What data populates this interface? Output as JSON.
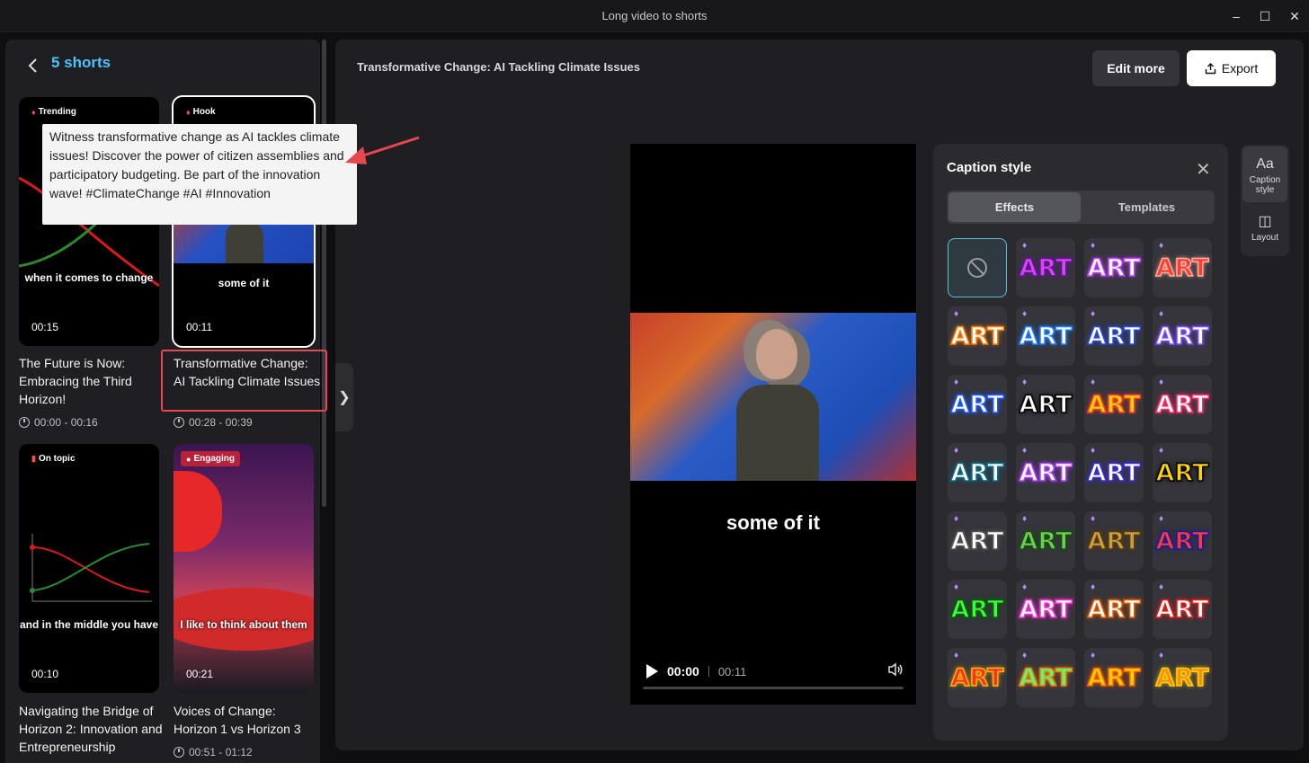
{
  "window": {
    "title": "Long video to shorts",
    "minimize": "–",
    "maximize": "☐",
    "close": "✕"
  },
  "left": {
    "back_icon": "chevron-left-icon",
    "title": "5 shorts",
    "cards": [
      {
        "badge": "Trending",
        "thumb_caption": "when it comes to change",
        "duration": "00:15",
        "title": "The Future is Now: Embracing the Third Horizon!",
        "time": "00:00 - 00:16"
      },
      {
        "badge": "Hook",
        "thumb_caption": "some of it",
        "duration": "00:11",
        "title": "Transformative Change: AI Tackling Climate Issues",
        "time": "00:28 - 00:39"
      },
      {
        "badge": "On topic",
        "thumb_caption": "and in the middle you have",
        "duration": "00:10",
        "title": "Navigating the Bridge of Horizon 2: Innovation and Entrepreneurship",
        "time": ""
      },
      {
        "badge": "Engaging",
        "thumb_caption": "I like to think about them",
        "duration": "00:21",
        "title": "Voices of Change: Horizon 1 vs Horizon 3",
        "time": "00:51 - 01:12"
      }
    ],
    "tooltip": "Witness transformative change as AI tackles climate issues! Discover the power of citizen assemblies and participatory budgeting. Be part of the innovation wave! #ClimateChange #AI #Innovation",
    "collapse_label": "❯"
  },
  "main": {
    "video_title": "Transformative Change: AI Tackling Climate Issues",
    "edit_more": "Edit more",
    "export": "Export",
    "player": {
      "caption": "some of it",
      "current_time": "00:00",
      "total_time": "00:11",
      "progress": 0
    }
  },
  "caption_panel": {
    "title": "Caption style",
    "tabs": [
      "Effects",
      "Templates"
    ],
    "active_tab": "Effects",
    "tile_text": "ART",
    "tiles": [
      {
        "fill": "none"
      },
      {
        "fill": "#e040fb",
        "stroke": "#5a1a8a"
      },
      {
        "fill": "#ffffff",
        "stroke": "#c03cff"
      },
      {
        "fill": "#ff3b2f",
        "stroke": "#ffb0a0"
      },
      {
        "fill": "#ffffff",
        "stroke": "#ff7a00"
      },
      {
        "fill": "#ffffff",
        "stroke": "#1e7bff"
      },
      {
        "fill": "#ffffff",
        "stroke": "#2a4bd8"
      },
      {
        "fill": "#ffffff",
        "stroke": "#7a4cff"
      },
      {
        "fill": "#ffffff",
        "stroke": "#1e5bff"
      },
      {
        "fill": "#ffffff",
        "stroke": "#000000"
      },
      {
        "fill": "#ffd400",
        "stroke": "#ff3b2f"
      },
      {
        "fill": "#ffffff",
        "stroke": "#ff2d6a"
      },
      {
        "fill": "#ffffff",
        "stroke": "#0a6b8a"
      },
      {
        "fill": "#ffffff",
        "stroke": "#b03cff"
      },
      {
        "fill": "#ffffff",
        "stroke": "#3a2bd8"
      },
      {
        "fill": "#ffd400",
        "stroke": "#000000"
      },
      {
        "fill": "#ffffff",
        "stroke": "#555555"
      },
      {
        "fill": "#6bd14a",
        "stroke": "#1a4a1a"
      },
      {
        "fill": "#c8a040",
        "stroke": "#5a3a10"
      },
      {
        "fill": "#ff3b2f",
        "stroke": "#1a1aa0"
      },
      {
        "fill": "#3bff3b",
        "stroke": "#0a5a0a"
      },
      {
        "fill": "#ffffff",
        "stroke": "#ff2dd8"
      },
      {
        "fill": "#ffffff",
        "stroke": "#e05a00"
      },
      {
        "fill": "#ffffff",
        "stroke": "#e0201a"
      },
      {
        "fill": "#ff2d2d",
        "stroke": "#ffb400"
      },
      {
        "fill": "#4aff7a",
        "stroke": "#ff7a00"
      },
      {
        "fill": "#ffd400",
        "stroke": "#ff5a00"
      },
      {
        "fill": "#ff8a1a",
        "stroke": "#ffd400"
      }
    ]
  },
  "side_tools": [
    {
      "icon": "Aa",
      "label": "Caption style"
    },
    {
      "icon": "◫",
      "label": "Layout"
    }
  ]
}
